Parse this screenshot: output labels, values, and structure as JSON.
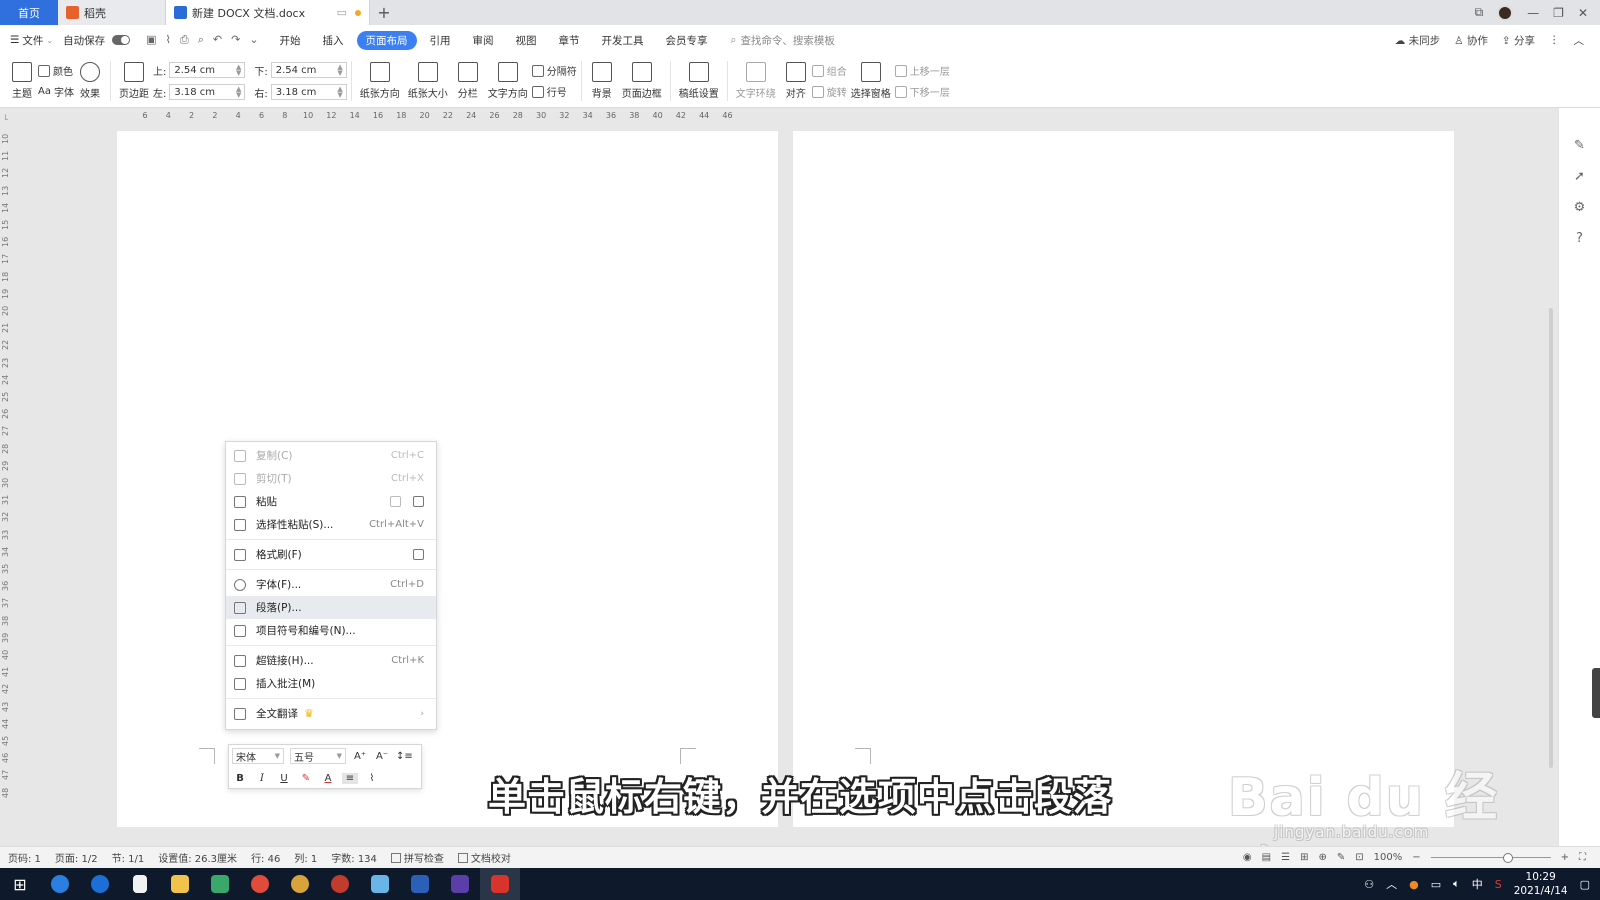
{
  "tabs": {
    "home": "首页",
    "tab1": "稻壳",
    "tab2": "新建 DOCX 文档.docx"
  },
  "menubar": {
    "file": "文件",
    "autosave": "自动保存",
    "tabs": [
      "开始",
      "插入",
      "页面布局",
      "引用",
      "审阅",
      "视图",
      "章节",
      "开发工具",
      "会员专享"
    ],
    "active_tab": "页面布局",
    "search_placeholder": "查找命令、搜索模板",
    "sync": "未同步",
    "collab": "协作",
    "share": "分享"
  },
  "ribbon": {
    "theme": "主题",
    "colors": "颜色",
    "fonts": "字体",
    "effects": "效果",
    "margins": "页边距",
    "top_label": "上:",
    "top_value": "2.54 cm",
    "bottom_label": "下:",
    "bottom_value": "2.54 cm",
    "left_label": "左:",
    "left_value": "3.18 cm",
    "right_label": "右:",
    "right_value": "3.18 cm",
    "orientation": "纸张方向",
    "size": "纸张大小",
    "columns": "分栏",
    "text_direction": "文字方向",
    "breaks": "分隔符",
    "line_numbers": "行号",
    "background": "背景",
    "page_border": "页面边框",
    "paper_setup": "稿纸设置",
    "wrap_text": "文字环绕",
    "align": "对齐",
    "group": "组合",
    "rotate": "旋转",
    "selection_pane": "选择窗格",
    "bring_forward": "上移一层",
    "send_backward": "下移一层"
  },
  "ruler": {
    "h_ticks": [
      "6",
      "4",
      "2",
      "2",
      "4",
      "6",
      "8",
      "10",
      "12",
      "14",
      "16",
      "18",
      "20",
      "22",
      "24",
      "26",
      "28",
      "30",
      "32",
      "34",
      "36",
      "38",
      "40",
      "42",
      "44",
      "46"
    ],
    "v_ticks": [
      "10",
      "11",
      "12",
      "13",
      "14",
      "15",
      "16",
      "17",
      "18",
      "19",
      "20",
      "21",
      "22",
      "23",
      "24",
      "25",
      "26",
      "27",
      "28",
      "29",
      "30",
      "31",
      "32",
      "33",
      "34",
      "35",
      "36",
      "37",
      "38",
      "39",
      "40",
      "41",
      "42",
      "43",
      "44",
      "45",
      "46",
      "47",
      "48"
    ]
  },
  "context_menu": {
    "copy": {
      "label": "复制(C)",
      "key": "Ctrl+C"
    },
    "cut": {
      "label": "剪切(T)",
      "key": "Ctrl+X"
    },
    "paste": {
      "label": "粘贴"
    },
    "paste_special": {
      "label": "选择性粘贴(S)...",
      "key": "Ctrl+Alt+V"
    },
    "format_painter": {
      "label": "格式刷(F)"
    },
    "font": {
      "label": "字体(F)...",
      "key": "Ctrl+D"
    },
    "paragraph": {
      "label": "段落(P)..."
    },
    "bullets": {
      "label": "项目符号和编号(N)..."
    },
    "hyperlink": {
      "label": "超链接(H)...",
      "key": "Ctrl+K"
    },
    "comment": {
      "label": "插入批注(M)"
    },
    "translate": {
      "label": "全文翻译"
    }
  },
  "minibar": {
    "font": "宋体",
    "size": "五号"
  },
  "subtitle": "单击鼠标右键，并在选项中点击段落",
  "watermark": {
    "logo": "Bai du 经验",
    "url": "jingyan.baidu.com"
  },
  "statusbar": {
    "page_num": "页码: 1",
    "pages": "页面: 1/2",
    "section": "节: 1/1",
    "position": "设置值: 26.3厘米",
    "row": "行: 46",
    "col": "列: 1",
    "words": "字数: 134",
    "spell": "拼写检查",
    "proof": "文档校对",
    "zoom": "100%"
  },
  "taskbar": {
    "time": "10:29",
    "date": "2021/4/14",
    "ime": "中"
  },
  "colors": {
    "accent": "#3b7ff2",
    "home_tab": "#2f6fde",
    "taskbar": "#0e1a2b"
  }
}
